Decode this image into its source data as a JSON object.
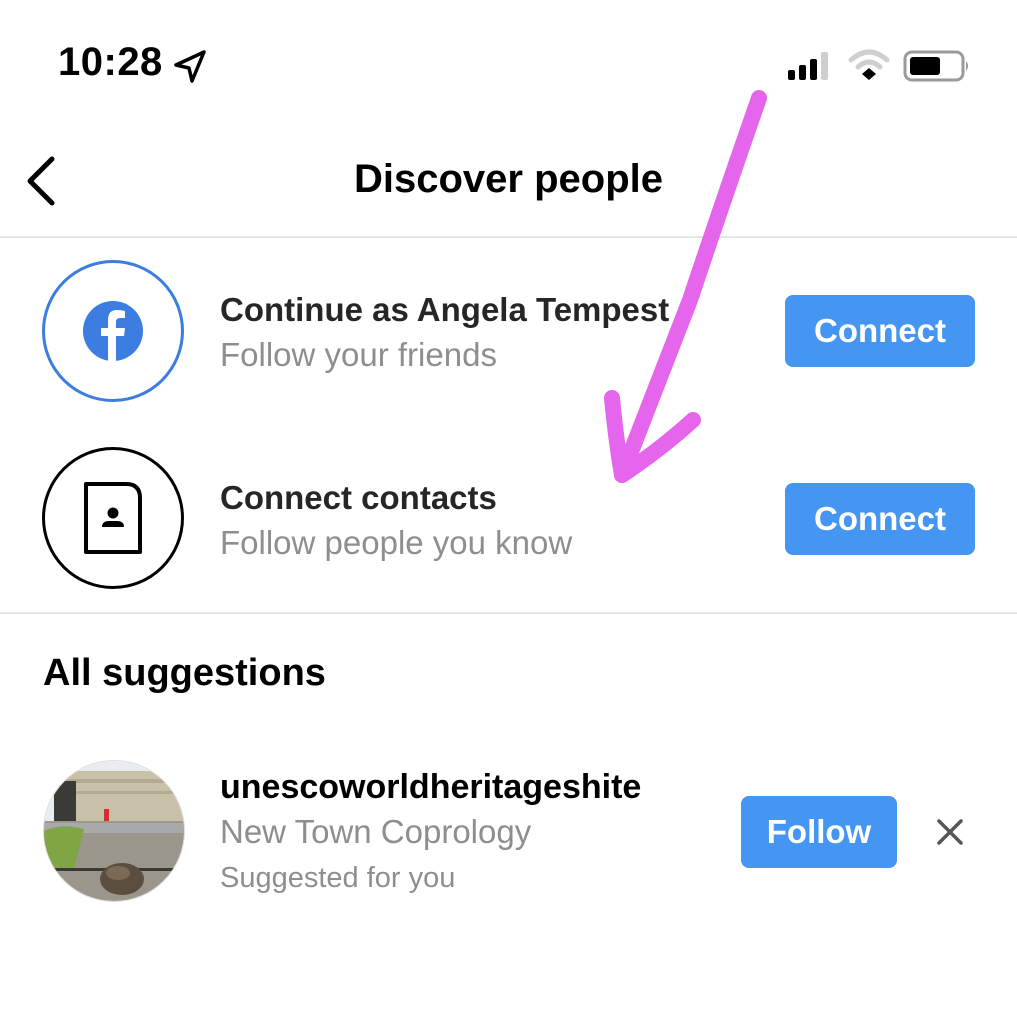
{
  "status_bar": {
    "time": "10:28",
    "icons": [
      "location-arrow-icon",
      "cellular-signal-icon",
      "wifi-icon",
      "battery-icon"
    ],
    "battery_level": 0.6
  },
  "header": {
    "title": "Discover people",
    "back_icon": "chevron-left-icon"
  },
  "connect_rows": [
    {
      "icon": "facebook-icon",
      "title": "Continue as Angela Tempest",
      "subtitle": "Follow your friends",
      "button_label": "Connect"
    },
    {
      "icon": "contact-card-icon",
      "title": "Connect contacts",
      "subtitle": "Follow people you know",
      "button_label": "Connect"
    }
  ],
  "suggestions": {
    "heading": "All suggestions",
    "items": [
      {
        "username": "unescoworldheritageshite",
        "full_name": "New Town Coprology",
        "reason": "Suggested for you",
        "button_label": "Follow",
        "dismiss_icon": "close-icon"
      }
    ]
  },
  "colors": {
    "accent_blue": "#4596f2",
    "facebook_blue": "#3b7de0",
    "annotation_magenta": "#e45eec",
    "secondary_text": "#8e8e8e"
  },
  "annotation": {
    "type": "hand-drawn arrow",
    "points_to": "Connect contacts"
  }
}
